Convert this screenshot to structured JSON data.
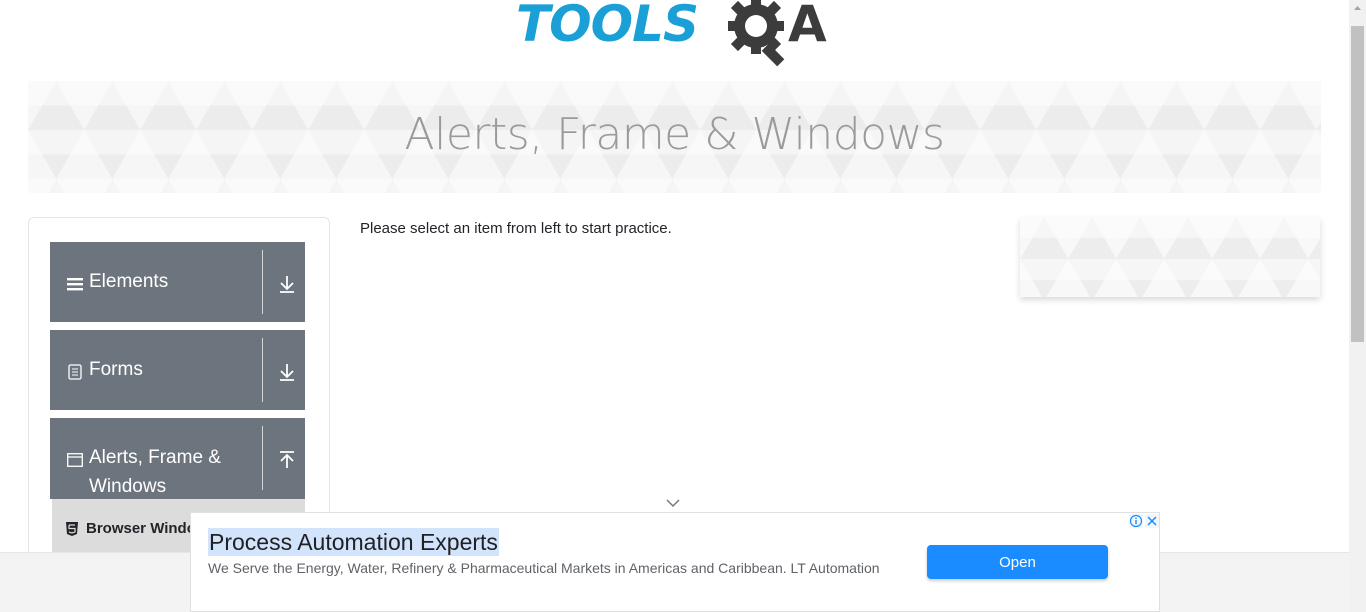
{
  "header": {
    "logo_text_left": "TOOLS",
    "logo_text_right": "A"
  },
  "banner": {
    "title": "Alerts, Frame & Windows"
  },
  "sidebar": {
    "groups": [
      {
        "label": "Elements",
        "icon": "hamburger-icon",
        "state": "collapsed"
      },
      {
        "label": "Forms",
        "icon": "document-icon",
        "state": "collapsed"
      },
      {
        "label": "Alerts, Frame & Windows",
        "icon": "window-icon",
        "state": "expanded"
      }
    ],
    "sub_items": [
      {
        "label": "Browser Windows",
        "icon": "html5-icon"
      }
    ]
  },
  "main": {
    "prompt": "Please select an item from left to start practice."
  },
  "ad": {
    "headline": "Process Automation Experts",
    "description": "We Serve the Energy, Water, Refinery & Pharmaceutical Markets in Americas and Caribbean. LT Automation",
    "button_label": "Open"
  },
  "colors": {
    "brand_blue": "#1a9fd6",
    "sidebar_group": "#6c757d",
    "ad_button": "#1a8cff"
  }
}
